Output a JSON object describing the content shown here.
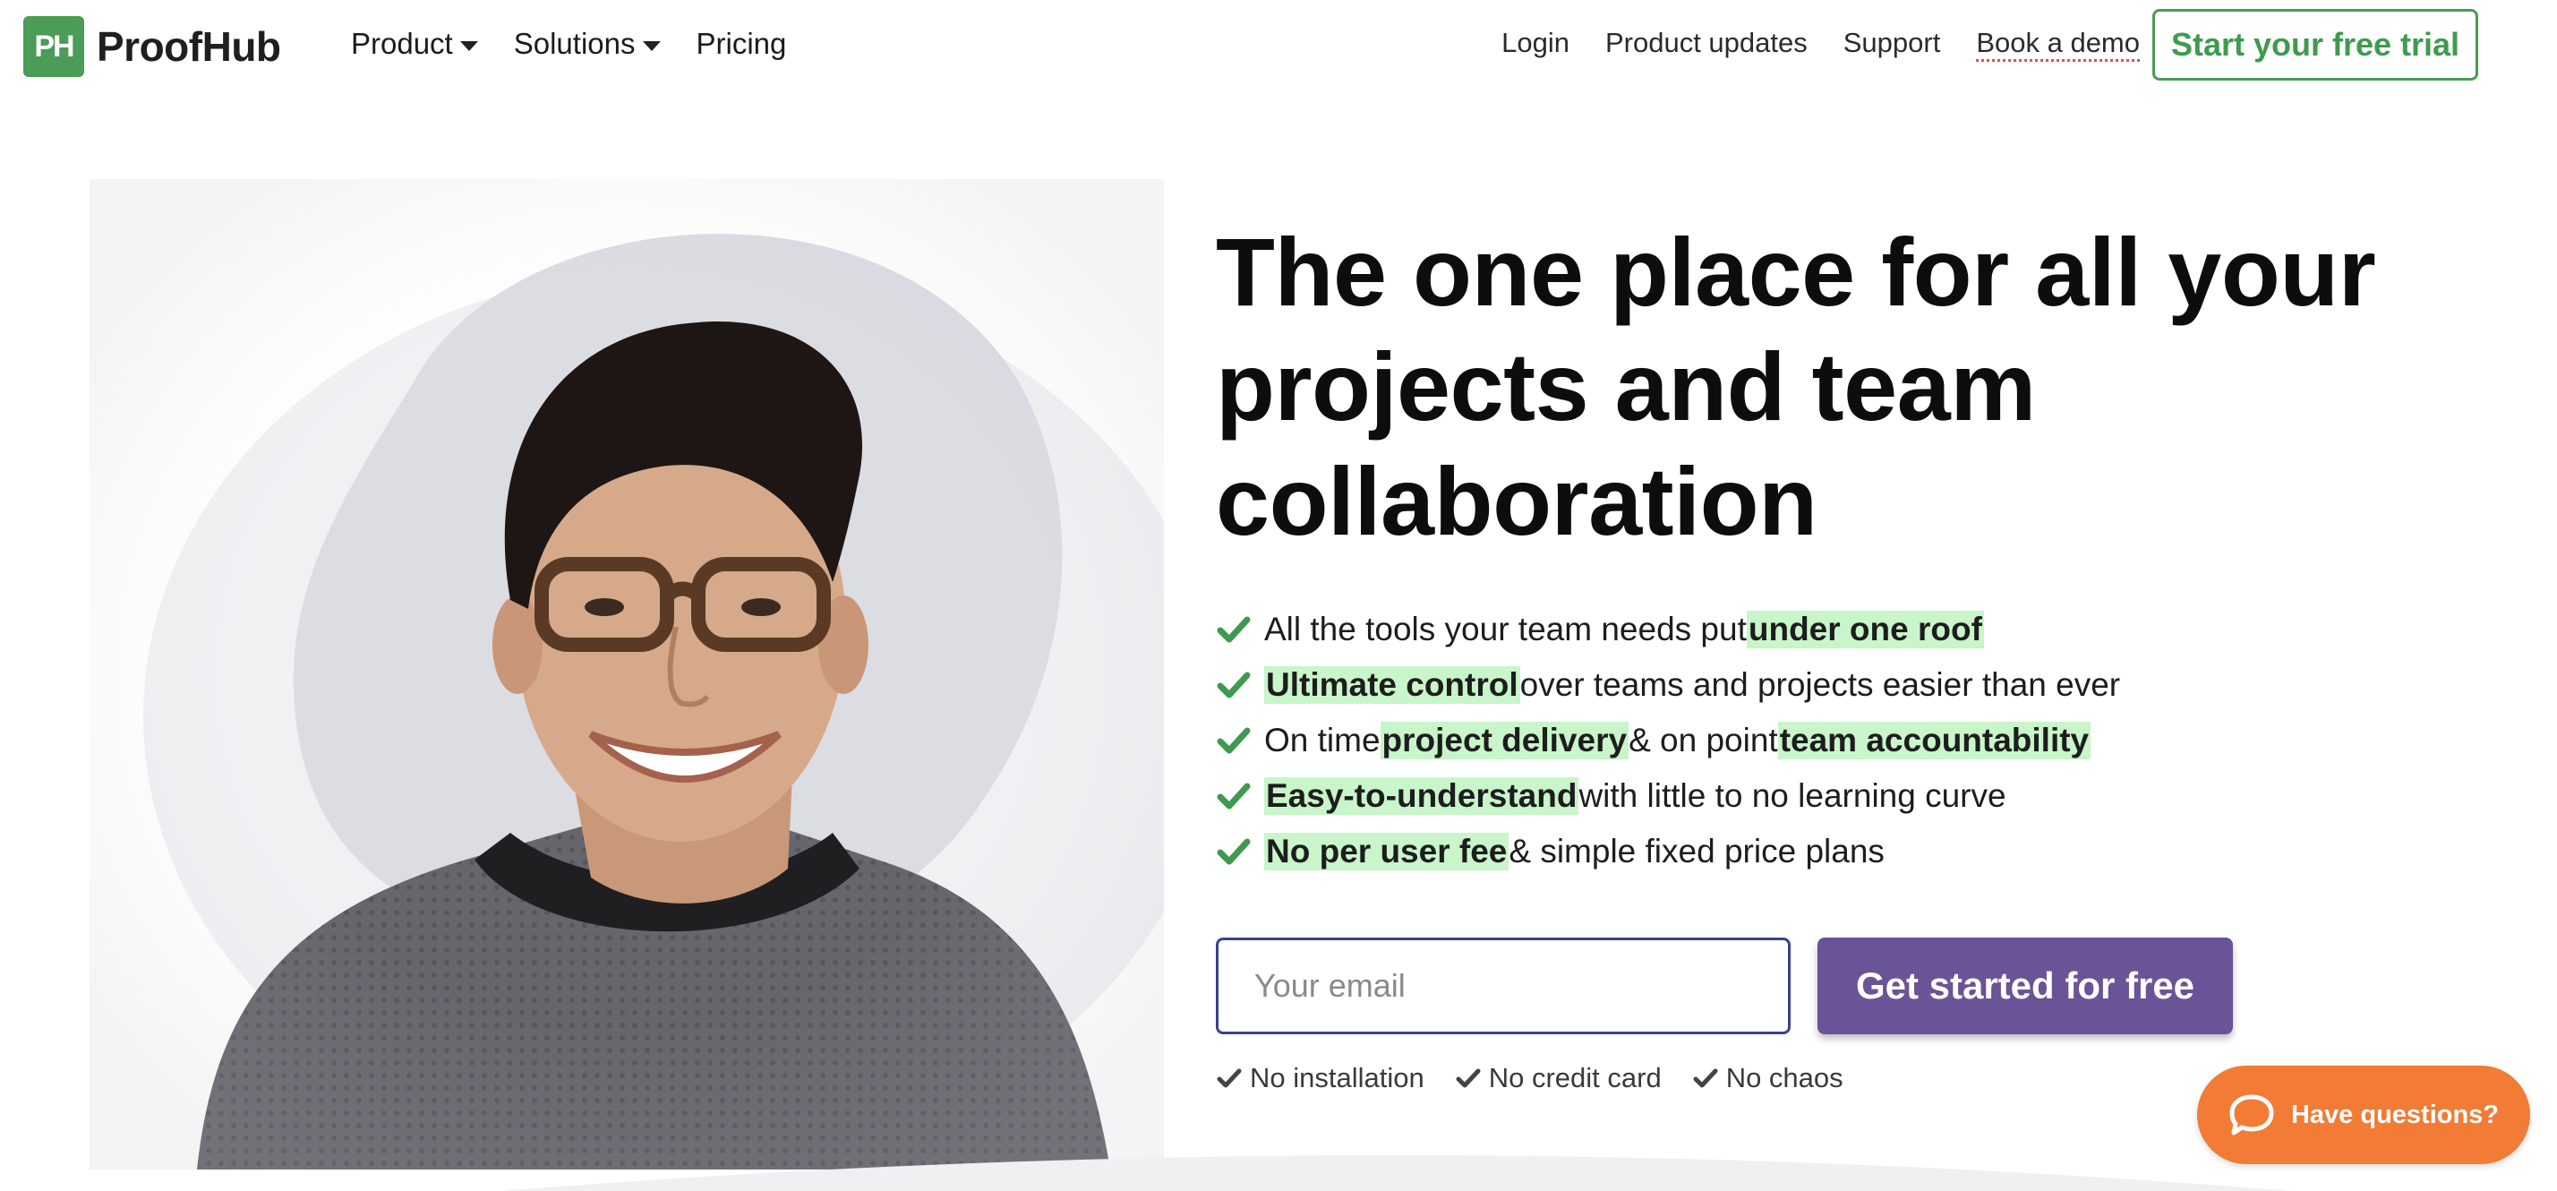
{
  "brand": {
    "logo_mark": "PH",
    "name": "ProofHub",
    "color": "#4a9c57"
  },
  "nav": {
    "left": [
      {
        "label": "Product",
        "dropdown": true
      },
      {
        "label": "Solutions",
        "dropdown": true
      },
      {
        "label": "Pricing",
        "dropdown": false
      }
    ],
    "right": [
      {
        "label": "Login"
      },
      {
        "label": "Product updates"
      },
      {
        "label": "Support"
      },
      {
        "label": "Book a demo"
      }
    ],
    "trial_button": "Start your free trial"
  },
  "hero": {
    "headline": "The one place for all your projects and team collaboration",
    "benefits": [
      {
        "parts": [
          "All the tools your team needs put ",
          "<under one roof>"
        ]
      },
      {
        "parts": [
          "<Ultimate control>",
          " over teams and projects easier than ever"
        ]
      },
      {
        "parts": [
          "On time ",
          "<project delivery>",
          " & on point ",
          "<team accountability>"
        ]
      },
      {
        "parts": [
          "<Easy-to-understand>",
          " with little to no learning curve"
        ]
      },
      {
        "parts": [
          "<No per user fee>",
          " & simple fixed price plans"
        ]
      }
    ],
    "email_placeholder": "Your email",
    "cta_button": "Get started for free",
    "perks": [
      "No installation",
      "No credit card",
      "No chaos"
    ]
  },
  "chat": {
    "label": "Have questions?"
  },
  "colors": {
    "accent_green": "#4a9c57",
    "highlight": "#c8f5c9",
    "cta_purple": "#6a5396",
    "input_border": "#3d3f8f",
    "chat_orange": "#f27b35"
  }
}
